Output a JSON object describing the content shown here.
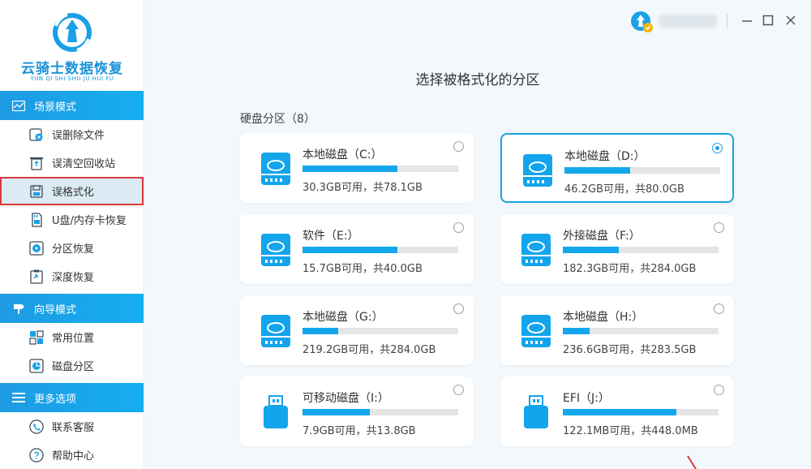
{
  "app": {
    "title": "云骑士数据恢复",
    "subtitle": "YUN QI SHI SHU JU HUI FU"
  },
  "sidebar": {
    "sections": [
      {
        "title": "场景模式",
        "icon": "scene-mode-icon",
        "items": [
          {
            "label": "误删除文件",
            "icon": "deleted-file-icon",
            "active": false
          },
          {
            "label": "误清空回收站",
            "icon": "recycle-bin-icon",
            "active": false
          },
          {
            "label": "误格式化",
            "icon": "format-icon",
            "active": true
          },
          {
            "label": "U盘/内存卡恢复",
            "icon": "sd-card-icon",
            "active": false
          },
          {
            "label": "分区恢复",
            "icon": "partition-icon",
            "active": false
          },
          {
            "label": "深度恢复",
            "icon": "deep-recovery-icon",
            "active": false
          }
        ]
      },
      {
        "title": "向导模式",
        "icon": "guide-mode-icon",
        "items": [
          {
            "label": "常用位置",
            "icon": "common-location-icon",
            "active": false
          },
          {
            "label": "磁盘分区",
            "icon": "disk-partition-icon",
            "active": false
          }
        ]
      },
      {
        "title": "更多选项",
        "icon": "menu-icon",
        "items": [
          {
            "label": "联系客服",
            "icon": "customer-service-icon",
            "active": false
          },
          {
            "label": "帮助中心",
            "icon": "help-icon",
            "active": false
          }
        ]
      }
    ]
  },
  "main": {
    "title": "选择被格式化的分区",
    "group_label": "硬盘分区（8）",
    "partitions": [
      {
        "name": "本地磁盘（C:）",
        "info": "30.3GB可用，共78.1GB",
        "used_fraction": 0.61,
        "type": "hdd",
        "selected": false
      },
      {
        "name": "本地磁盘（D:）",
        "info": "46.2GB可用，共80.0GB",
        "used_fraction": 0.42,
        "type": "hdd",
        "selected": true
      },
      {
        "name": "软件（E:）",
        "info": "15.7GB可用，共40.0GB",
        "used_fraction": 0.61,
        "type": "hdd",
        "selected": false
      },
      {
        "name": "外接磁盘（F:）",
        "info": "182.3GB可用，共284.0GB",
        "used_fraction": 0.36,
        "type": "hdd",
        "selected": false
      },
      {
        "name": "本地磁盘（G:）",
        "info": "219.2GB可用，共284.0GB",
        "used_fraction": 0.23,
        "type": "hdd",
        "selected": false
      },
      {
        "name": "本地磁盘（H:）",
        "info": "236.6GB可用，共283.5GB",
        "used_fraction": 0.17,
        "type": "hdd",
        "selected": false
      },
      {
        "name": "可移动磁盘（I:）",
        "info": "7.9GB可用，共13.8GB",
        "used_fraction": 0.43,
        "type": "usb",
        "selected": false
      },
      {
        "name": "EFI（J:）",
        "info": "122.1MB可用，共448.0MB",
        "used_fraction": 0.73,
        "type": "usb",
        "selected": false
      }
    ]
  },
  "colors": {
    "accent": "#14a7ee",
    "sidebar_header": "#1e9be3",
    "active_outline": "#d63b3b"
  }
}
